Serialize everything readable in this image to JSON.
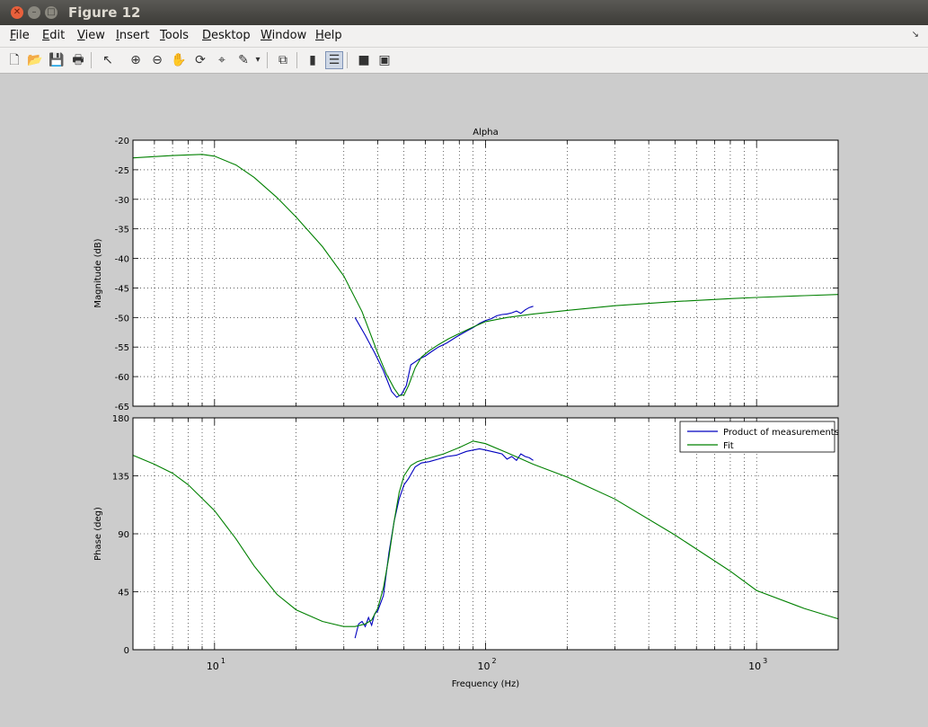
{
  "window": {
    "title": "Figure 12"
  },
  "menus": [
    {
      "key": "F",
      "rest": "ile"
    },
    {
      "key": "E",
      "rest": "dit"
    },
    {
      "key": "V",
      "rest": "iew"
    },
    {
      "key": "I",
      "rest": "nsert"
    },
    {
      "key": "T",
      "rest": "ools"
    },
    {
      "key": "D",
      "rest": "esktop"
    },
    {
      "key": "W",
      "rest": "indow"
    },
    {
      "key": "H",
      "rest": "elp"
    }
  ],
  "toolbar": {
    "icons": [
      "new-figure-icon",
      "open-file-icon",
      "save-icon",
      "print-icon",
      "pointer-icon",
      "zoom-in-icon",
      "zoom-out-icon",
      "pan-hand-icon",
      "rotate-3d-icon",
      "data-cursor-icon",
      "brush-icon",
      "brush-dropdown-icon",
      "link-plot-icon",
      "colorbar-icon",
      "legend-icon",
      "hide-plot-tools-icon",
      "show-plot-tools-icon"
    ]
  },
  "chart_data": [
    {
      "type": "line",
      "title": "Alpha",
      "xlabel": "",
      "ylabel": "Magnitude (dB)",
      "xscale": "log",
      "xlim": [
        5,
        2000
      ],
      "ylim": [
        -65,
        -20
      ],
      "yticks": [
        -20,
        -25,
        -30,
        -35,
        -40,
        -45,
        -50,
        -55,
        -60,
        -65
      ],
      "grid": true,
      "series": [
        {
          "name": "Product of measurements",
          "color": "#0000bf",
          "x": [
            33,
            36,
            39,
            42,
            45,
            47,
            49,
            51,
            53,
            55,
            57,
            60,
            63,
            67,
            72,
            78,
            85,
            90,
            95,
            100,
            105,
            110,
            115,
            120,
            125,
            130,
            135,
            140,
            145,
            150
          ],
          "y": [
            -50,
            -53,
            -56,
            -59,
            -62.5,
            -63.5,
            -63,
            -61.5,
            -58,
            -57.5,
            -57,
            -56.5,
            -55.8,
            -55,
            -54.3,
            -53.3,
            -52.3,
            -51.7,
            -51,
            -50.5,
            -50.2,
            -49.7,
            -49.5,
            -49.4,
            -49.2,
            -48.9,
            -49.3,
            -48.7,
            -48.3,
            -48.1
          ]
        },
        {
          "name": "Fit",
          "color": "#008000",
          "x": [
            5,
            7,
            9,
            10,
            12,
            14,
            17,
            20,
            25,
            30,
            35,
            40,
            43,
            46,
            48,
            50,
            52,
            55,
            58,
            62,
            67,
            73,
            80,
            90,
            100,
            120,
            150,
            200,
            300,
            500,
            800,
            1000,
            1500,
            2000
          ],
          "y": [
            -23,
            -22.6,
            -22.4,
            -22.7,
            -24.2,
            -26.3,
            -29.7,
            -33,
            -38,
            -43,
            -49,
            -56,
            -59.5,
            -62,
            -63.2,
            -63.1,
            -61.5,
            -58.5,
            -56.7,
            -55.6,
            -54.6,
            -53.6,
            -52.7,
            -51.6,
            -50.7,
            -50,
            -49.4,
            -48.8,
            -48,
            -47.3,
            -46.8,
            -46.6,
            -46.3,
            -46.1
          ]
        }
      ]
    },
    {
      "type": "line",
      "title": "",
      "xlabel": "Frequency  (Hz)",
      "ylabel": "Phase (deg)",
      "xscale": "log",
      "xlim": [
        5,
        2000
      ],
      "ylim": [
        0,
        180
      ],
      "yticks": [
        0,
        45,
        90,
        135,
        180
      ],
      "xtick_labels": [
        {
          "base": "10",
          "exp": "1"
        },
        {
          "base": "10",
          "exp": "2"
        },
        {
          "base": "10",
          "exp": "3"
        }
      ],
      "grid": true,
      "legend": {
        "position": "top-right",
        "entries": [
          "Product of measurements",
          "Fit"
        ]
      },
      "series": [
        {
          "name": "Product of measurements",
          "color": "#0000bf",
          "x": [
            33,
            34,
            35,
            36,
            37,
            38,
            39,
            40,
            42,
            44,
            46,
            48,
            50,
            52,
            55,
            58,
            62,
            67,
            72,
            78,
            85,
            90,
            95,
            100,
            105,
            110,
            115,
            120,
            125,
            130,
            135,
            140,
            145,
            150
          ],
          "y": [
            9,
            20,
            22,
            18,
            25,
            19,
            28,
            30,
            42,
            75,
            100,
            117,
            128,
            133,
            142,
            145,
            146,
            148,
            150,
            151,
            154,
            155,
            156,
            155,
            154,
            153,
            152,
            148,
            150,
            147,
            152,
            150,
            149,
            147
          ]
        },
        {
          "name": "Fit",
          "color": "#008000",
          "x": [
            5,
            6,
            7,
            8,
            10,
            12,
            14,
            17,
            20,
            25,
            30,
            33,
            36,
            38,
            40,
            42,
            44,
            46,
            48,
            50,
            53,
            56,
            60,
            70,
            80,
            90,
            100,
            120,
            150,
            200,
            300,
            500,
            800,
            1000,
            1500,
            2000
          ],
          "y": [
            151,
            144,
            137,
            128,
            108,
            86,
            65,
            43,
            31,
            22,
            18,
            18,
            20,
            23,
            32,
            48,
            72,
            100,
            122,
            135,
            143,
            146,
            148,
            152,
            157,
            162,
            160,
            153,
            144,
            134,
            117,
            89,
            61,
            46,
            32,
            24
          ]
        }
      ]
    }
  ]
}
